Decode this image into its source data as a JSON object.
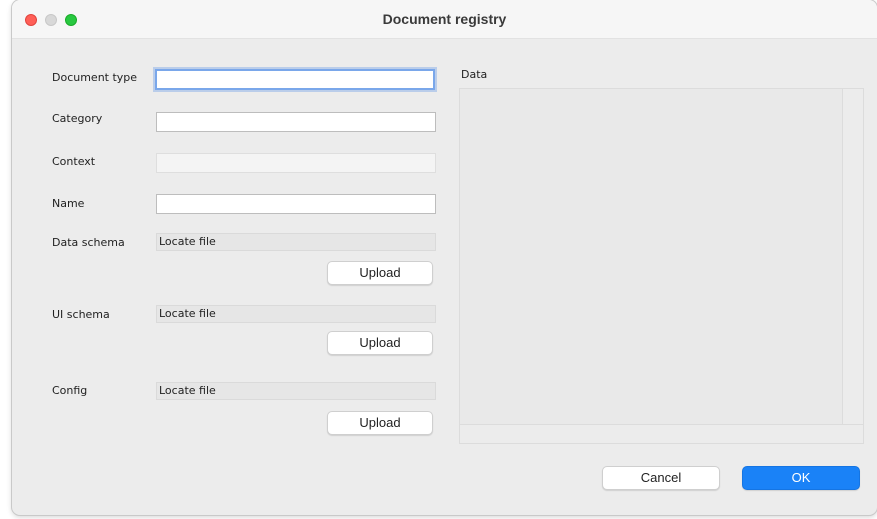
{
  "window": {
    "title": "Document registry"
  },
  "form": {
    "document_type": {
      "label": "Document type",
      "value": ""
    },
    "category": {
      "label": "Category",
      "value": ""
    },
    "context": {
      "label": "Context",
      "value": ""
    },
    "name": {
      "label": "Name",
      "value": ""
    },
    "data_schema": {
      "label": "Data schema",
      "file_text": "Locate file",
      "upload_label": "Upload"
    },
    "ui_schema": {
      "label": "UI schema",
      "file_text": "Locate file",
      "upload_label": "Upload"
    },
    "config": {
      "label": "Config",
      "file_text": "Locate file",
      "upload_label": "Upload"
    }
  },
  "data_panel": {
    "label": "Data"
  },
  "footer": {
    "cancel_label": "Cancel",
    "ok_label": "OK"
  },
  "colors": {
    "accent": "#1a82f7",
    "focus_ring": "#7aa7ea",
    "close": "#ff5f57",
    "minimize": "#d8d8d8",
    "maximize": "#28c840"
  }
}
